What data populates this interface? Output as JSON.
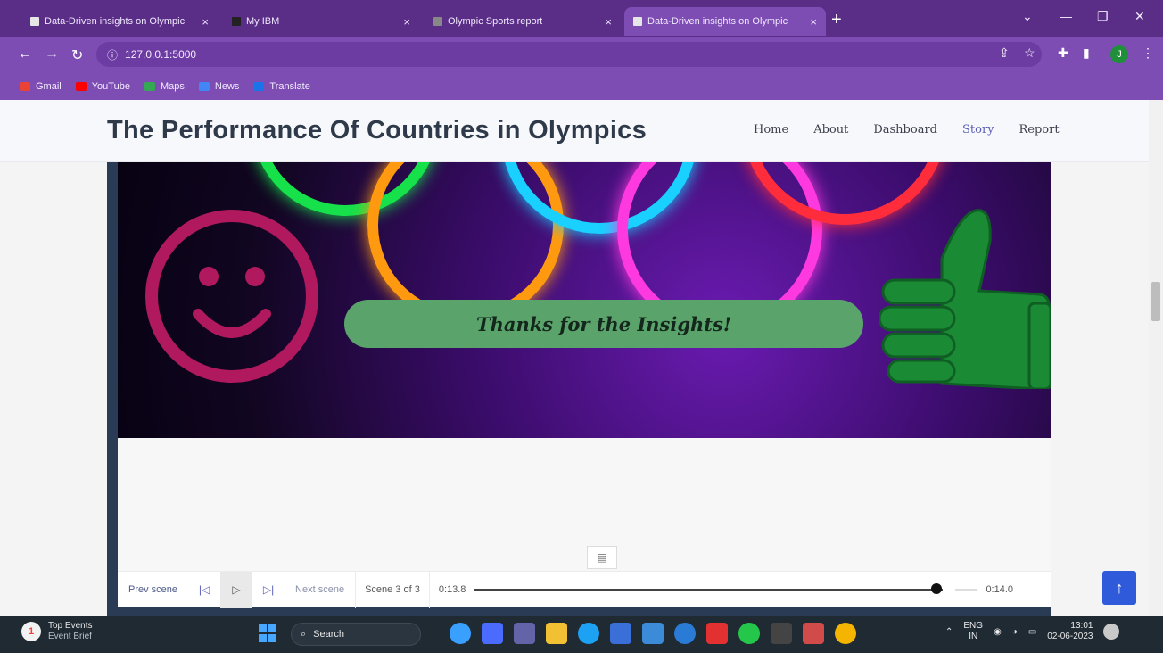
{
  "browser": {
    "tabs": [
      {
        "title": "Data-Driven insights on Olympic",
        "active": false
      },
      {
        "title": "My IBM",
        "active": false
      },
      {
        "title": "Olympic Sports report",
        "active": false
      },
      {
        "title": "Data-Driven insights on Olympic",
        "active": true
      }
    ],
    "address": "127.0.0.1:5000",
    "profile_initial": "J",
    "bookmarks": [
      "Gmail",
      "YouTube",
      "Maps",
      "News",
      "Translate"
    ]
  },
  "header": {
    "brand": "The Performance Of Countries in Olympics",
    "nav": [
      "Home",
      "About",
      "Dashboard",
      "Story",
      "Report"
    ],
    "active_nav": "Story"
  },
  "banner": {
    "caption": "Thanks for the Insights!",
    "colors": {
      "green": "#1a8a35",
      "smiley": "#b0195d",
      "pill": "#5aa36a"
    }
  },
  "story_controls": {
    "prev": "Prev scene",
    "next": "Next scene",
    "scene": "Scene 3 of 3",
    "time_current": "0:13.8",
    "time_total": "0:14.0",
    "progress_fraction": 0.985
  },
  "taskbar": {
    "news_title": "Top Events",
    "news_sub": "Event Brief",
    "news_badge": "1",
    "search": "Search",
    "lang": "ENG",
    "region": "IN",
    "time": "13:01",
    "date": "02-06-2023"
  }
}
